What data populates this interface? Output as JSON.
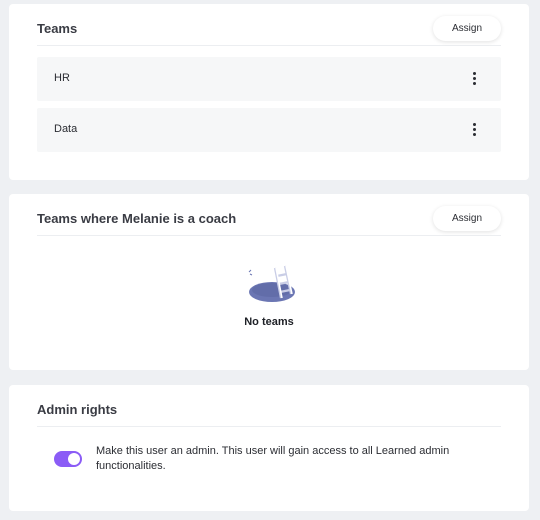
{
  "teams_card": {
    "title": "Teams",
    "assign_label": "Assign",
    "items": [
      {
        "name": "HR"
      },
      {
        "name": "Data"
      }
    ]
  },
  "coach_card": {
    "title": "Teams where Melanie is a coach",
    "assign_label": "Assign",
    "empty_text": "No teams",
    "empty_icon": "empty-ladder-hole-illustration"
  },
  "admin_card": {
    "title": "Admin rights",
    "toggle_on": true,
    "description": "Make this user an admin. This user will gain access to all Learned admin functionalities."
  },
  "colors": {
    "accent": "#8b5cf6",
    "illustration": "#6b76b3"
  }
}
